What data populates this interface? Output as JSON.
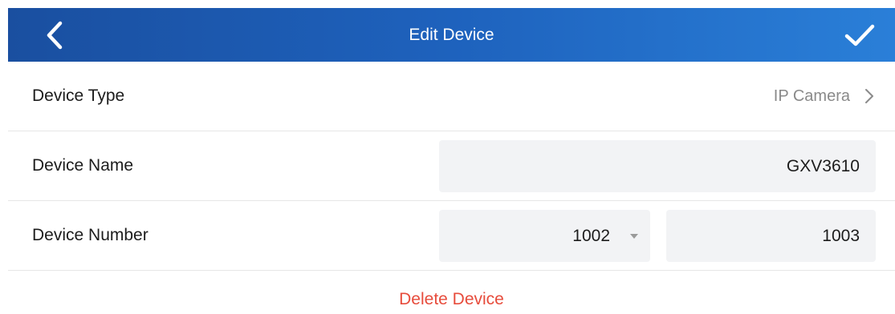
{
  "header": {
    "title": "Edit Device",
    "back_icon": "chevron-left-icon",
    "confirm_icon": "checkmark-icon"
  },
  "device_type": {
    "label": "Device Type",
    "value": "IP Camera",
    "icon": "chevron-right-icon"
  },
  "device_name": {
    "label": "Device Name",
    "value": "GXV3610"
  },
  "device_number": {
    "label": "Device Number",
    "primary": "1002",
    "secondary": "1003",
    "dropdown_icon": "caret-down-icon"
  },
  "actions": {
    "delete_label": "Delete Device"
  },
  "colors": {
    "header_start": "#1a4fa0",
    "header_end": "#2a7fd8",
    "field_bg": "#f2f3f5",
    "danger": "#e74c3c",
    "muted": "#8a8a8a"
  }
}
